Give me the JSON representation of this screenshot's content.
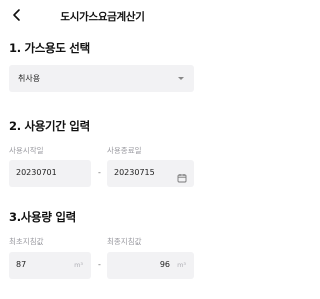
{
  "header": {
    "title": "도시가스요금계산기"
  },
  "section1": {
    "title": "1. 가스용도 선택",
    "select_value": "취사용"
  },
  "section2": {
    "title": "2. 사용기간 입력",
    "start_label": "사용시작일",
    "end_label": "사용종료일",
    "start_value": "20230701",
    "end_value": "20230715",
    "separator": "-"
  },
  "section3": {
    "title": "3.사용량 입력",
    "first_label": "최초지침값",
    "last_label": "최종지침값",
    "first_value": "87",
    "last_value": "96",
    "unit": "m³",
    "separator": "-"
  },
  "icons": {
    "back": "back-arrow-icon",
    "calendar": "calendar-icon",
    "caret": "caret-down-icon"
  }
}
